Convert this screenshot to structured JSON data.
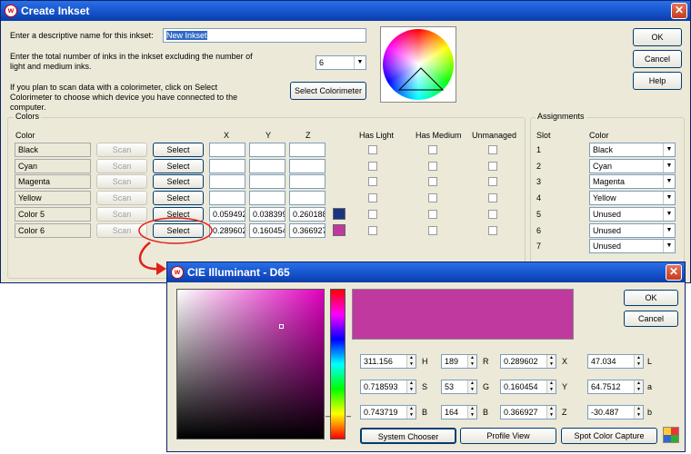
{
  "main": {
    "title": "Create Inkset",
    "name_prompt": "Enter a descriptive name for this inkset:",
    "name_value": "New Inkset",
    "count_prompt": "Enter the total number of inks in the inkset excluding the number of light and medium inks.",
    "count_value": "6",
    "scan_prompt": "If you plan to scan data with a colorimeter, click on Select Colorimeter to choose which device you have connected to the computer.",
    "select_colorimeter": "Select Colorimeter",
    "ok": "OK",
    "cancel": "Cancel",
    "help": "Help"
  },
  "colors": {
    "group_label": "Colors",
    "headers": {
      "color": "Color",
      "x": "X",
      "y": "Y",
      "z": "Z",
      "has_light": "Has Light",
      "has_medium": "Has Medium",
      "unmanaged": "Unmanaged"
    },
    "scan_label": "Scan",
    "select_label": "Select",
    "rows": [
      {
        "name": "Black",
        "x": "",
        "y": "",
        "z": "",
        "swatch": ""
      },
      {
        "name": "Cyan",
        "x": "",
        "y": "",
        "z": "",
        "swatch": ""
      },
      {
        "name": "Magenta",
        "x": "",
        "y": "",
        "z": "",
        "swatch": ""
      },
      {
        "name": "Yellow",
        "x": "",
        "y": "",
        "z": "",
        "swatch": ""
      },
      {
        "name": "Color 5",
        "x": "0.059492",
        "y": "0.038399",
        "z": "0.260188",
        "swatch": "#1a3580"
      },
      {
        "name": "Color 6",
        "x": "0.289602",
        "y": "0.160454",
        "z": "0.366927",
        "swatch": "#c0399f"
      }
    ]
  },
  "assignments": {
    "group_label": "Assignments",
    "slot_header": "Slot",
    "color_header": "Color",
    "rows": [
      {
        "slot": "1",
        "color": "Black"
      },
      {
        "slot": "2",
        "color": "Cyan"
      },
      {
        "slot": "3",
        "color": "Magenta"
      },
      {
        "slot": "4",
        "color": "Yellow"
      },
      {
        "slot": "5",
        "color": "Unused"
      },
      {
        "slot": "6",
        "color": "Unused"
      },
      {
        "slot": "7",
        "color": "Unused"
      }
    ]
  },
  "picker": {
    "title": "CIE Illuminant - D65",
    "preview_color": "#c0399f",
    "ok": "OK",
    "cancel": "Cancel",
    "fields": [
      {
        "value": "311.156",
        "label": "H"
      },
      {
        "value": "0.718593",
        "label": "S"
      },
      {
        "value": "0.743719",
        "label": "B"
      }
    ],
    "rgb": [
      {
        "value": "189",
        "label": "R"
      },
      {
        "value": "53",
        "label": "G"
      },
      {
        "value": "164",
        "label": "B"
      }
    ],
    "xyz": [
      {
        "value": "0.289602",
        "label": "X"
      },
      {
        "value": "0.160454",
        "label": "Y"
      },
      {
        "value": "0.366927",
        "label": "Z"
      }
    ],
    "lab": [
      {
        "value": "47.034",
        "label": "L"
      },
      {
        "value": "64.7512",
        "label": "a"
      },
      {
        "value": "-30.487",
        "label": "b"
      }
    ],
    "system_chooser": "System Chooser",
    "profile_view": "Profile View",
    "spot_capture": "Spot Color Capture"
  }
}
